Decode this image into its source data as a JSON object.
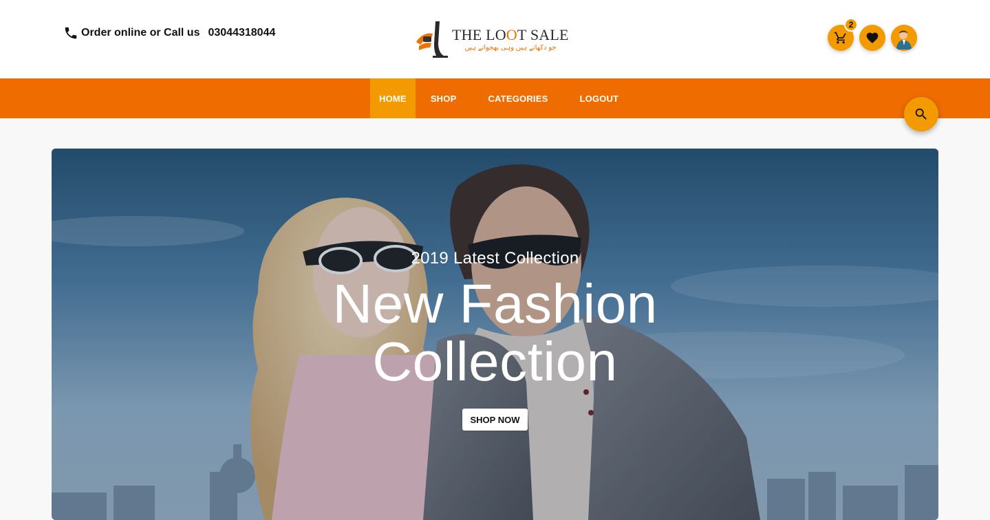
{
  "header": {
    "contact_text": "Order online or Call us",
    "phone_number": "03044318044",
    "logo": {
      "title_part1": "THE LO",
      "title_accent": "O",
      "title_part2": "T SALE",
      "tagline": "جو دکھاتے ہیں وہی بھجواتے ہیں"
    },
    "cart_count": "2"
  },
  "nav": {
    "items": [
      {
        "label": "HOME",
        "active": true
      },
      {
        "label": "SHOP",
        "active": false
      },
      {
        "label": "CATEGORIES",
        "active": false
      },
      {
        "label": "LOGOUT",
        "active": false
      }
    ]
  },
  "hero": {
    "subtitle": "2019 Latest Collection",
    "title_line1": "New Fashion",
    "title_line2": "Collection",
    "button_label": "SHOP NOW",
    "prev_arrow": "‹",
    "next_arrow": "›"
  },
  "colors": {
    "brand_orange": "#ef6c00",
    "accent_orange": "#f39a00",
    "text_dark": "#111111",
    "white": "#ffffff"
  },
  "icons": {
    "phone": "phone-icon",
    "logo": "logo-mark-icon",
    "cart": "cart-icon",
    "heart": "heart-icon",
    "avatar": "user-avatar-icon",
    "search": "search-icon"
  }
}
